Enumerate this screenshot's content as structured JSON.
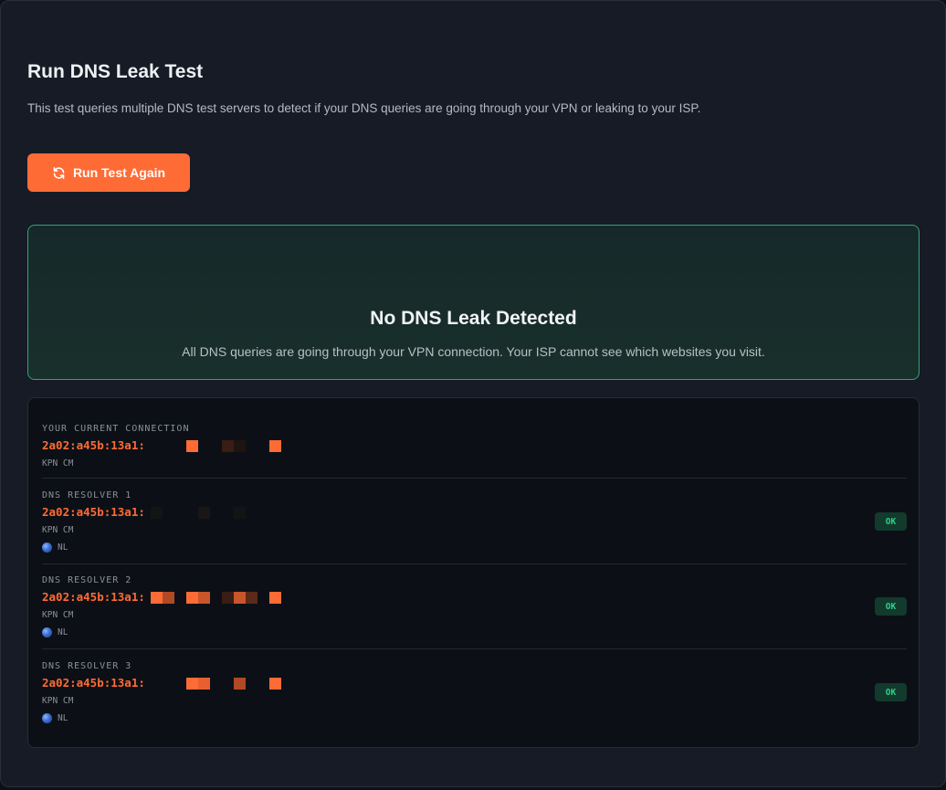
{
  "header": {
    "title": "Run DNS Leak Test",
    "description": "This test queries multiple DNS test servers to detect if your DNS queries are going through your VPN or leaking to your ISP."
  },
  "actions": {
    "run_label": "Run Test Again",
    "run_icon": "refresh-icon"
  },
  "result": {
    "status": "ok",
    "title": "No DNS Leak Detected",
    "message": "All DNS queries are going through your VPN connection. Your ISP cannot see which websites you visit.",
    "accent": "#2fa574"
  },
  "connection": {
    "label": "YOUR CURRENT CONNECTION",
    "ip": "2a02:a45b:13a1:",
    "isp": "KPN CM"
  },
  "resolvers": [
    {
      "label": "DNS RESOLVER 1",
      "ip": "2a02:a45b:13a1:",
      "isp": "KPN CM",
      "country": "NL",
      "status": "OK"
    },
    {
      "label": "DNS RESOLVER 2",
      "ip": "2a02:a45b:13a1:",
      "isp": "KPN CM",
      "country": "NL",
      "status": "OK"
    },
    {
      "label": "DNS RESOLVER 3",
      "ip": "2a02:a45b:13a1:",
      "isp": "KPN CM",
      "country": "NL",
      "status": "OK"
    }
  ],
  "colors": {
    "accent": "#ff6b35",
    "ok": "#2fd08a",
    "background": "#161b26"
  }
}
